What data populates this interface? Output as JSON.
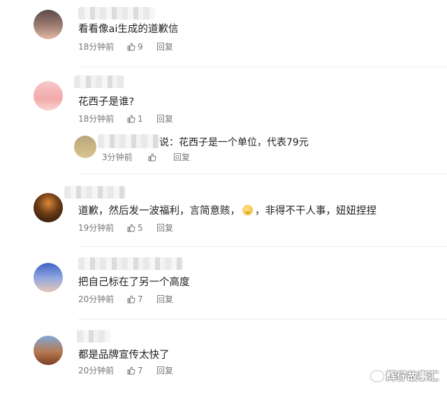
{
  "comments": [
    {
      "text": "看看像ai生成的道歉信",
      "time": "18分钟前",
      "likes": "9",
      "reply_label": "回复"
    },
    {
      "text": "花西子是谁?",
      "time": "18分钟前",
      "likes": "1",
      "reply_label": "回复"
    },
    {
      "text": "道歉，然后发一波福利，言简意赅，",
      "text_after_emoji": "，非得不干人事，妞妞捏捏",
      "time": "19分钟前",
      "likes": "5",
      "reply_label": "回复"
    },
    {
      "text": "把自己标在了另一个高度",
      "time": "20分钟前",
      "likes": "7",
      "reply_label": "回复"
    },
    {
      "text": "都是品牌宣传太快了",
      "time": "20分钟前",
      "likes": "7",
      "reply_label": "回复"
    }
  ],
  "nested_reply": {
    "text": "说：花西子是一个单位，代表79元",
    "time": "3分钟前",
    "likes": "",
    "reply_label": "回复"
  },
  "watermark": "辉仔故事汇",
  "colors": {
    "meta_text": "#777777",
    "divider": "#ececec"
  }
}
